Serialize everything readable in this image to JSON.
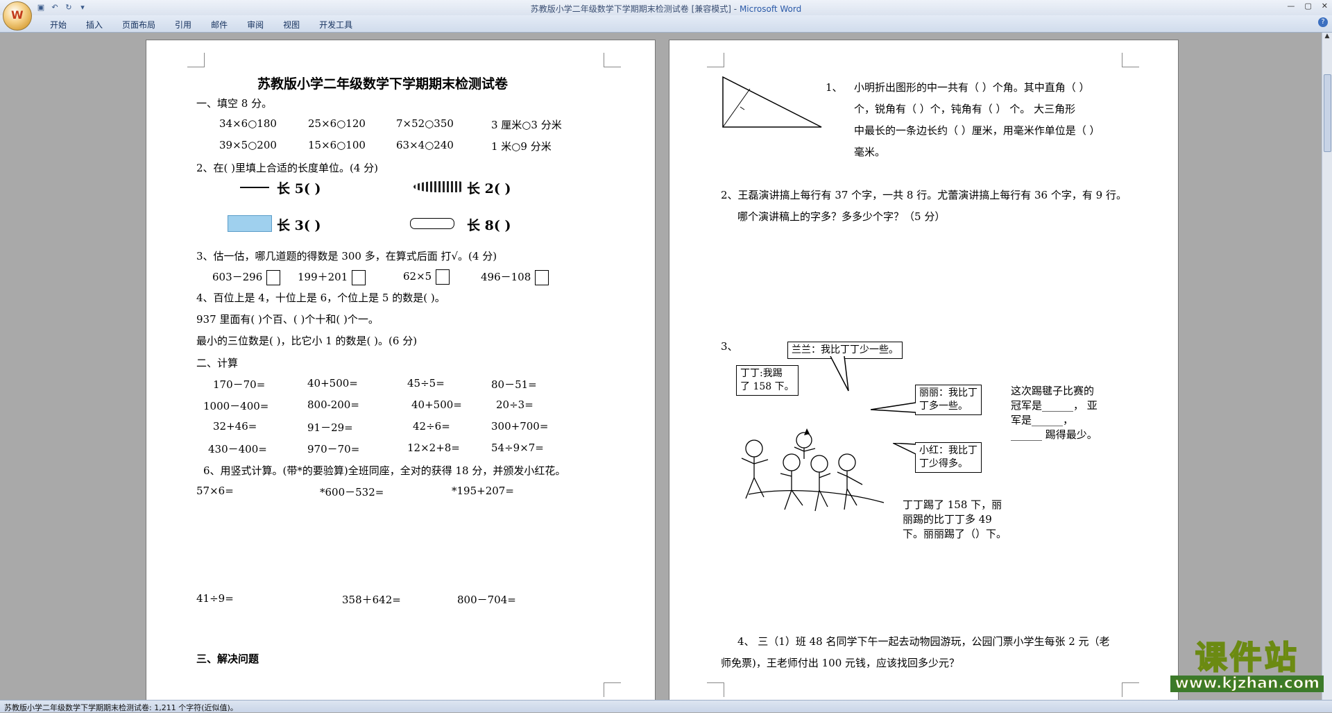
{
  "window": {
    "title_doc": "苏教版小学二年级数学下学期期末检测试卷 [兼容模式]",
    "title_sep": " - ",
    "title_app": "Microsoft Word",
    "office_button": "W"
  },
  "ribbon": {
    "tabs": [
      "开始",
      "插入",
      "页面布局",
      "引用",
      "邮件",
      "审阅",
      "视图",
      "开发工具"
    ],
    "help": "?"
  },
  "page1": {
    "title": "苏教版小学二年级数学下学期期末检测试卷",
    "s1_heading": "一、填空 8 分。",
    "s1_r1": [
      "34×6○180",
      "25×6○120",
      "7×52○350",
      "3 厘米○3 分米"
    ],
    "s1_r2": [
      "39×5○200",
      "15×6○100",
      "63×4○240",
      "1 米○9 分米"
    ],
    "q2": "2、在(   )里填上合适的长度单位。(4 分)",
    "q2_items": [
      "长 5(        )",
      "长 2(          )",
      "长 3(        )",
      "长 8(          )"
    ],
    "q3": "3、估一估，哪几道题的得数是 300 多，在算式后面   打√。(4 分)",
    "q3_items": [
      "603－296",
      "199＋201",
      "62×5",
      "496－108"
    ],
    "q4a": "4、百位上是 4，十位上是 6，个位上是 5 的数是(     )。",
    "q4b": "937 里面有(     )个百、(     )个十和(     )个一。",
    "q4c": "最小的三位数是(     )，比它小 1 的数是(     )。(6 分)",
    "s2_heading": "二、计算",
    "calc_rows": [
      [
        "170－70=",
        "40+500=",
        "45÷5=",
        "80－51="
      ],
      [
        "1000－400=",
        "800-200=",
        "40+500=",
        "20÷3="
      ],
      [
        "32+46=",
        "91－29=",
        "42÷6=",
        "300+700="
      ],
      [
        "430－400=",
        "970－70=",
        "12×2+8=",
        "54÷9×7="
      ]
    ],
    "q6": "6、用竖式计算。(带*的要验算)全班同座，全对的获得 18 分，并颁发小红花。",
    "q6_r1": [
      "57×6=",
      "*600－532=",
      "*195+207="
    ],
    "q6_r2": [
      "41÷9=",
      "358＋642=",
      "800－704="
    ],
    "s3_heading": "三、解决问题"
  },
  "page2": {
    "q1_num": "1、",
    "q1_l1": "小明折出图形的中一共有（    ）个角。其中直角（    ）",
    "q1_l2": "个，锐角有（    ）个，钝角有（    ）   个。 大三角形",
    "q1_l3": "中最长的一条边长约（    ）厘米，用毫米作单位是（    ）",
    "q1_l4": "毫米。",
    "q2_l1": "2、王磊演讲搞上每行有 37 个字，一共 8 行。尤蕾演讲搞上每行有 36 个字，有 9 行。",
    "q2_l2": "哪个演讲稿上的字多？多多少个字？（5 分）",
    "q3_num": "3、",
    "bubble_lanlan": "兰兰：我比丁丁少一些。",
    "bubble_dingding": [
      "丁丁:我踢",
      "了 158 下。"
    ],
    "bubble_lili": [
      "丽丽：我比丁",
      "丁多一些。"
    ],
    "bubble_xiaohong": [
      "小红：我比丁",
      "丁少得多。"
    ],
    "q3_right": [
      "这次踢毽子比赛的",
      "冠军是______，  亚",
      "军是______，",
      "______  踢得最少。"
    ],
    "q3_bottom": [
      "丁丁踢了 158 下，丽",
      "丽踢的比丁丁多  49",
      "下。丽丽踢了（）下。"
    ],
    "q4_l1": "4、  三（1）班 48 名同学下午一起去动物园游玩，公园门票小学生每张 2 元（老",
    "q4_l2": "师免票)，王老师付出 100 元钱，应该找回多少元？"
  },
  "statusbar": {
    "text": "苏教版小学二年级数学下学期期末检测试卷: 1,211 个字符(近似值)。"
  },
  "watermark": {
    "main": "课件站",
    "url": "www.kjzhan.com"
  },
  "colors": {
    "titlebar": "#dbe3ef",
    "ribbon": "#d1dcec",
    "workspace": "#a9a9a9",
    "watermark": "#f7e40d"
  }
}
